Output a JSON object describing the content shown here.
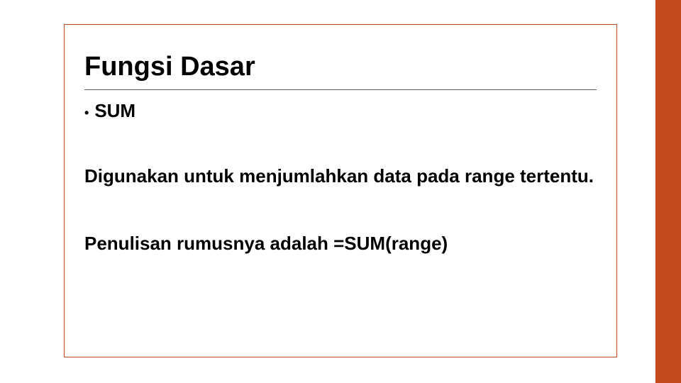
{
  "slide": {
    "title": "Fungsi Dasar",
    "bullet": {
      "marker": "•",
      "label": "SUM"
    },
    "description": "Digunakan untuk menjumlahkan data pada range tertentu.",
    "formula": "Penulisan rumusnya adalah =SUM(range)"
  },
  "colors": {
    "accent": "#c34a1a",
    "border": "#b84a1e"
  }
}
